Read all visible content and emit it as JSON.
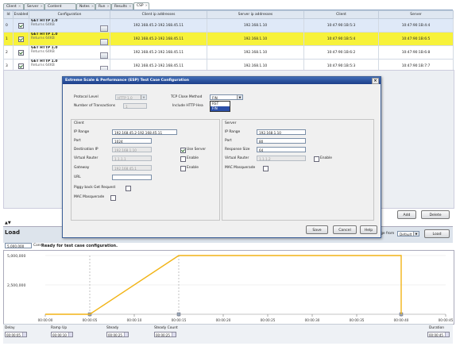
{
  "tabs": [
    {
      "label": "Client"
    },
    {
      "label": "Server"
    },
    {
      "label": "Content Files"
    },
    {
      "label": "Notes"
    },
    {
      "label": "Run"
    },
    {
      "label": "Results"
    },
    {
      "label": "CSP"
    }
  ],
  "grid": {
    "headers": [
      "Id",
      "Enabled",
      "Configuration",
      "Client ip addresses",
      "Server ip addresses",
      "Client",
      "Server"
    ],
    "rows": [
      {
        "id": "0",
        "name": "GET HTTP 1.0",
        "sub": "Returns 64KB",
        "client_ip": "192.168.45.2-192.168.45.11",
        "server_ip": "192.168.1.10",
        "client": "10:47:90:1B:5:3",
        "server": "10:47:90:1B:4:4"
      },
      {
        "id": "1",
        "name": "GET HTTP 1.0",
        "sub": "Returns 64KB",
        "client_ip": "192.168.45.2-192.168.45.11",
        "server_ip": "192.168.1.10",
        "client": "10:47:90:1B:5:4",
        "server": "10:47:90:1B:6:5"
      },
      {
        "id": "2",
        "name": "GET HTTP 1.0",
        "sub": "Returns 64KB",
        "client_ip": "192.168.45.2-192.168.45.11",
        "server_ip": "192.168.1.10",
        "client": "10:47:90:1B:6:2",
        "server": "10:47:90:1B:6:8"
      },
      {
        "id": "3",
        "name": "GET HTTP 1.0",
        "sub": "Returns 64KB",
        "client_ip": "192.168.45.2-192.168.45.11",
        "server_ip": "192.168.1.10",
        "client": "10:47:90:1B:5:3",
        "server": "10:47:90:1B:7:7"
      }
    ]
  },
  "dialog": {
    "title": "Extreme Scale & Performance (ESP) Test Case Configuration",
    "close": "×",
    "protocol_level_label": "Protocol Level",
    "protocol_level_value": "HTTP 1.0",
    "num_transactions_label": "Number of Transactions",
    "num_transactions_value": "1",
    "tcp_close_label": "TCP Close Method",
    "tcp_close_value": "FIN",
    "include_header_label": "Include HTTP Hea",
    "tcp_options": [
      "RST",
      "FIN"
    ],
    "client": {
      "group_label": "Client",
      "ip_range_label": "IP Range",
      "ip_range_value": "192.168.45.2-192.168.45.11",
      "port_label": "Port",
      "port_value": "1024",
      "dest_ip_label": "Destination IP",
      "dest_ip_value": "192.168.1.10",
      "use_server_label": "Use Server",
      "virtual_router_label": "Virtual Router",
      "virtual_router_value": "1.1.1.1",
      "gateway_label": "Gateway",
      "gateway_value": "192.168.45.1",
      "enable_label": "Enable",
      "url_label": "URL",
      "url_value": "",
      "piggy_back_label": "Piggy back Get Request",
      "mac_masquerade_label": "MAC Masquerade"
    },
    "server": {
      "group_label": "Server",
      "ip_range_label": "IP Range",
      "ip_range_value": "192.168.1.10",
      "port_label": "Port",
      "port_value": "80",
      "response_size_label": "Response Size",
      "response_size_value": "64",
      "virtual_router_label": "Virtual Router",
      "virtual_router_value": "1.1.1.2",
      "enable_label": "Enable",
      "mac_masquerade_label": "MAC Masquerade"
    },
    "save_label": "Save",
    "cancel_label": "Cancel",
    "help_label": "Help"
  },
  "right_buttons": {
    "add": "Add",
    "delete": "Delete"
  },
  "load": {
    "title": "Load",
    "connections_value": "5,000,000",
    "connections_unit": "Conn",
    "status": "Ready for test case configuration.",
    "page_from_label": "Page from",
    "page_from_value": "Default",
    "load_button": "Load"
  },
  "chart_data": {
    "type": "line",
    "y_ticks": [
      "5,000,000",
      "2,500,000"
    ],
    "x_ticks": [
      "00:00:00",
      "00:00:05",
      "00:00:10",
      "00:00:15",
      "00:00:20",
      "00:00:25",
      "00:00:30",
      "00:00:35",
      "00:00:40",
      "00:00:45"
    ],
    "x": [
      "00:00:00",
      "00:00:05",
      "00:00:15",
      "00:00:40",
      "00:00:40"
    ],
    "y": [
      0,
      0,
      5000000,
      5000000,
      0
    ],
    "line_color": "#f2b416"
  },
  "bottom": {
    "delay_label": "Delay",
    "delay_value": "00:00:05",
    "ramp_up_label": "Ramp Up",
    "ramp_up_value": "00:00:10",
    "steady_label": "Steady",
    "steady_value": "00:00:25",
    "steady_count_label": "Steady Count",
    "steady_count_value": "00:00:25",
    "duration_label": "Duration",
    "duration_value": "00:00:45"
  },
  "colors": {
    "selected_row": "#f7f23a",
    "title_bar": "#1d3f8a",
    "chart_line": "#f2b416"
  }
}
